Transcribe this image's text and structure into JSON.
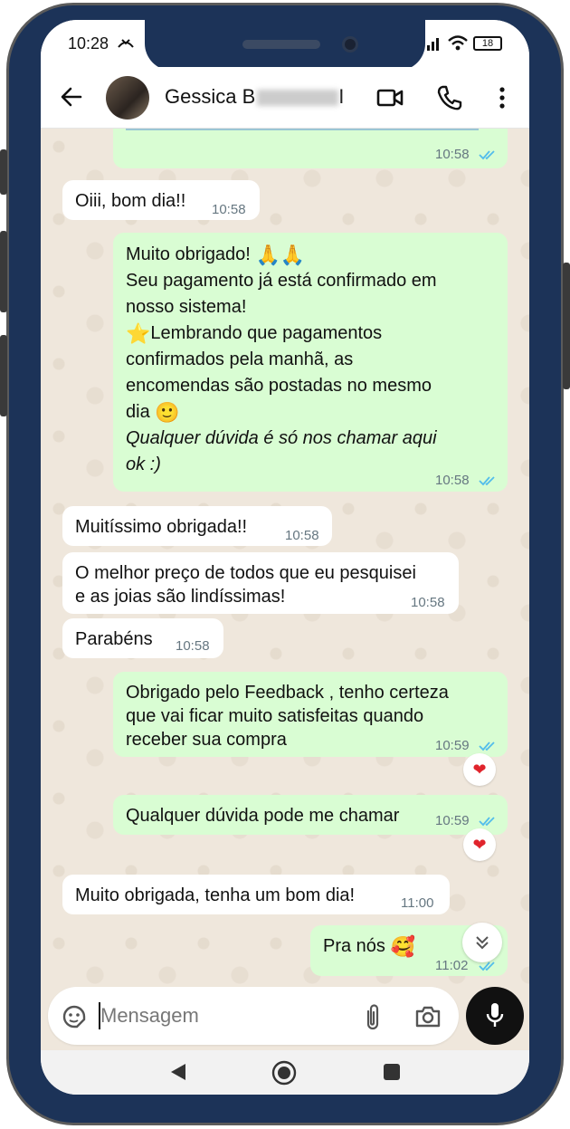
{
  "status": {
    "time": "10:28",
    "battery": "18"
  },
  "contact": {
    "first_name": "Gessica",
    "last_name_prefix": "B",
    "last_name_tail": "I"
  },
  "header_icons": [
    "back-arrow-icon",
    "video-call-icon",
    "phone-call-icon",
    "more-vert-icon"
  ],
  "messages": [
    {
      "dir": "out",
      "text_lines": [
        ""
      ],
      "time": "10:58",
      "read": true
    },
    {
      "dir": "in",
      "text_lines": [
        "Oiii, bom dia!!"
      ],
      "time": "10:58"
    },
    {
      "dir": "out",
      "line1": "Muito obrigado!",
      "line2": "Seu pagamento já está confirmado em",
      "line3": "nosso sistema!",
      "line4": "Lembrando que pagamentos",
      "line5": "confirmados pela manhã, as",
      "line6": "encomendas são postadas no mesmo",
      "line7": "dia",
      "line8": "Qualquer dúvida é só nos chamar aqui",
      "line9": "ok :)",
      "time": "10:58",
      "read": true
    },
    {
      "dir": "in",
      "line1": "Muitíssimo obrigada!!",
      "time": "10:58"
    },
    {
      "dir": "in",
      "line1": "O melhor preço de todos que eu pesquisei",
      "line2": "e as joias são lindíssimas!",
      "time": "10:58"
    },
    {
      "dir": "in",
      "line1": "Parabéns",
      "time": "10:58"
    },
    {
      "dir": "out",
      "line1": "Obrigado pelo Feedback , tenho certeza",
      "line2": "que vai ficar muito satisfeitas quando",
      "line3": "receber sua compra",
      "time": "10:59",
      "read": true,
      "reaction": "heart"
    },
    {
      "dir": "out",
      "line1": "Qualquer dúvida pode me chamar",
      "time": "10:59",
      "read": true,
      "reaction": "heart"
    },
    {
      "dir": "in",
      "line1": "Muito obrigada, tenha um bom dia!",
      "time": "11:00"
    },
    {
      "dir": "out",
      "line1": "Pra nós",
      "time": "11:02",
      "read": true
    }
  ],
  "composer": {
    "placeholder": "Mensagem"
  },
  "colors": {
    "frame": "#1c3358",
    "outgoing": "#d9fdd3",
    "incoming": "#ffffff",
    "tick": "#53bdeb",
    "chat_bg": "#efe7dc"
  }
}
